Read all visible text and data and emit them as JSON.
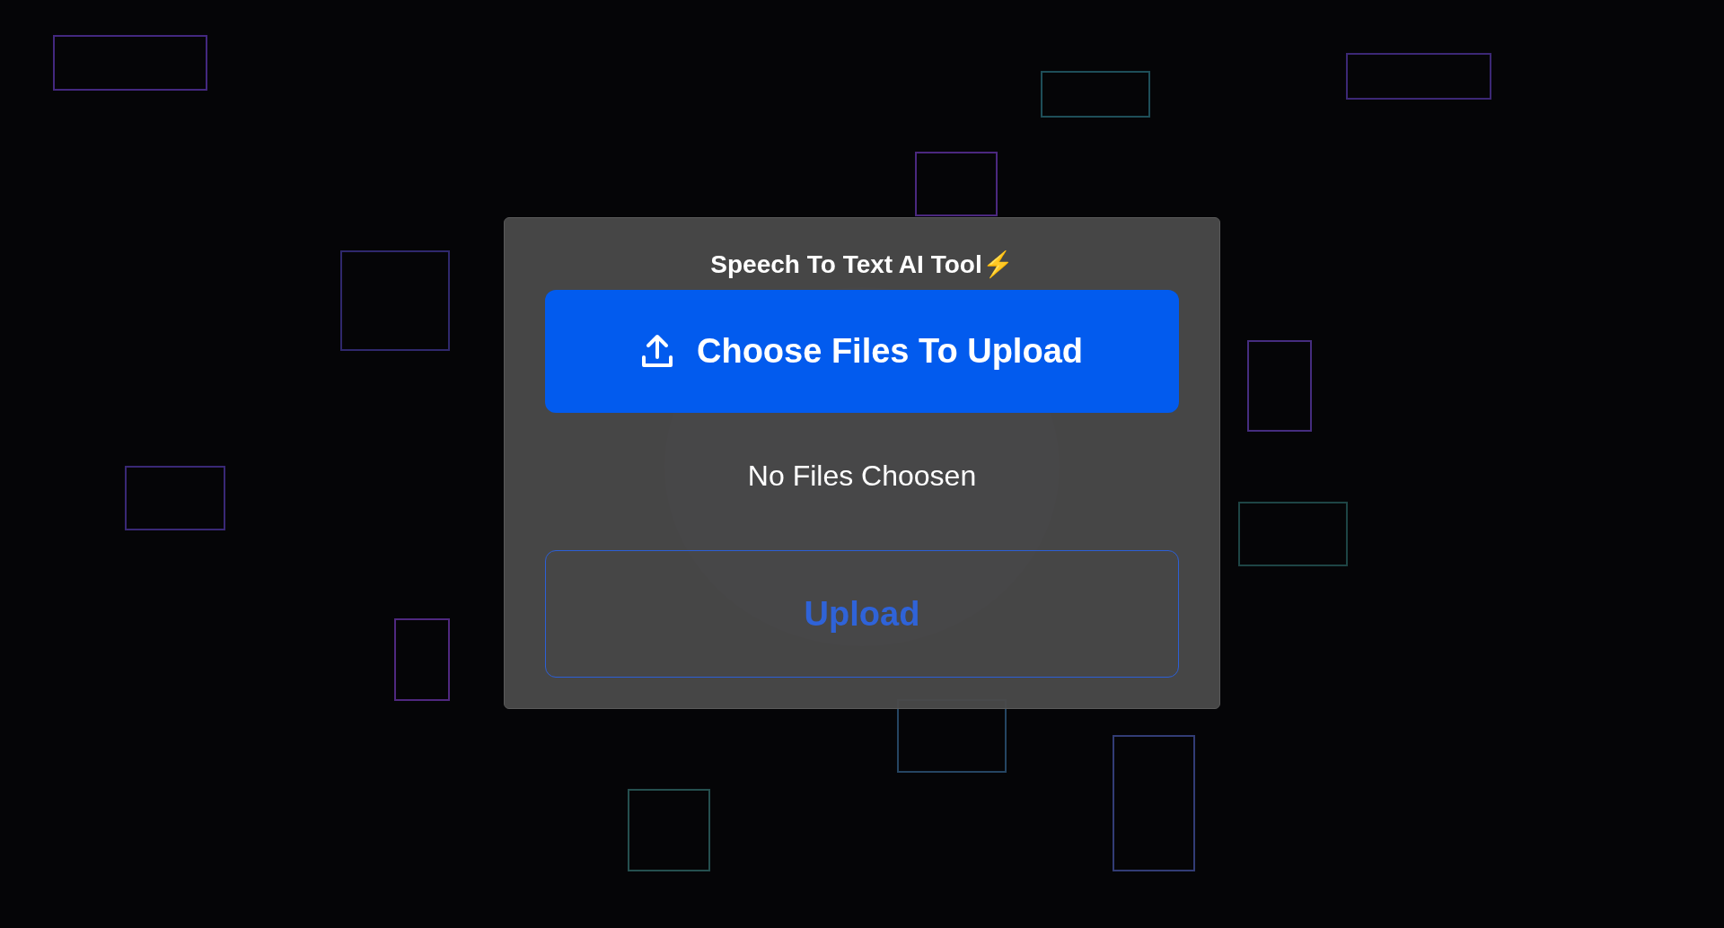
{
  "card": {
    "title": "Speech To Text AI Tool⚡",
    "choose_button": {
      "label": "Choose Files To Upload"
    },
    "file_status": "No Files Choosen",
    "upload_button": {
      "label": "Upload"
    }
  }
}
